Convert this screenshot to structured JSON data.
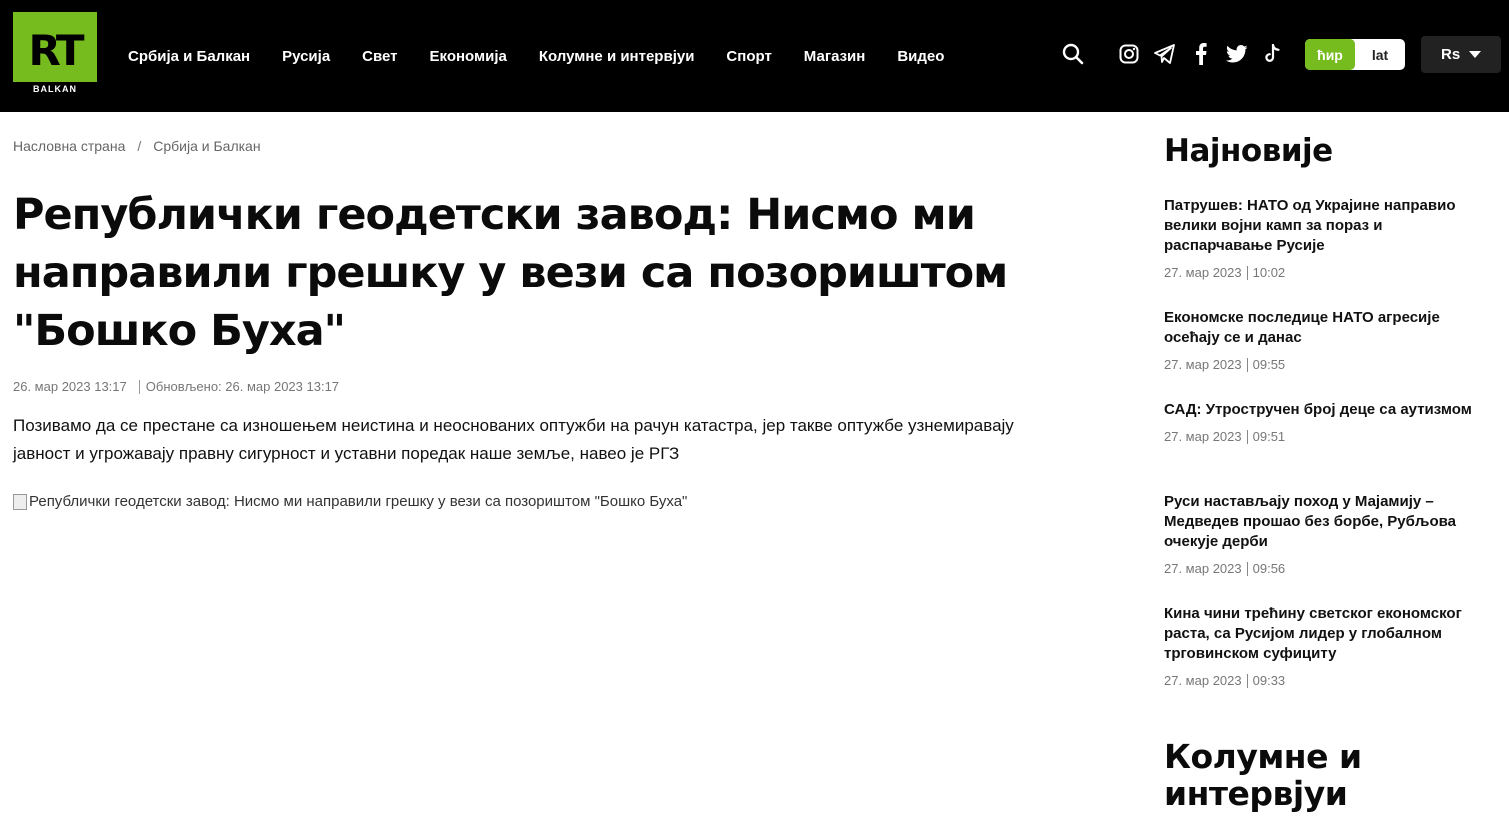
{
  "brand": {
    "logo_text": "RT",
    "logo_sub": "BALKAN",
    "accent": "#77bc1f",
    "header_bg": "#000000"
  },
  "nav": {
    "items": [
      {
        "label": "Србија и Балкан"
      },
      {
        "label": "Русија"
      },
      {
        "label": "Свет"
      },
      {
        "label": "Економија"
      },
      {
        "label": "Колумне и интервјуи"
      },
      {
        "label": "Спорт"
      },
      {
        "label": "Магазин"
      },
      {
        "label": "Видео"
      }
    ]
  },
  "header_icons": [
    "search-icon",
    "instagram-icon",
    "telegram-icon",
    "facebook-icon",
    "twitter-icon",
    "tiktok-icon"
  ],
  "script_toggle": {
    "cyr": "ћир",
    "lat": "lat",
    "selected": "ћир"
  },
  "region": {
    "label": "Rs"
  },
  "breadcrumb": {
    "home": "Насловна страна",
    "sep": "/",
    "section": "Србија и Балкан"
  },
  "article": {
    "title": "Републички геодетски завод: Нисмо ми направили грешку у вези са позориштом \"Бошко Буха\"",
    "published": "26. мар 2023 13:17",
    "updated": "Обновљено: 26. мар 2023 13:17",
    "lead": "Позивамо да се престане са изношењем неистина и неоснованих оптужби на рачун катастра, јер такве оптужбе узнемиравају јавност и угрожавају правну сигурност и уставни поредак наше земље, навео је РГЗ",
    "image_alt": "Републички геодетски завод: Нисмо ми направили грешку у вези са позориштом \"Бошко Буха\""
  },
  "sidebar": {
    "title": "Најновије",
    "items": [
      {
        "headline": "Патрушев: НАТО од Украјине направио велики војни камп за пораз и распарчавање Русије",
        "date": "27. мар 2023",
        "time": "10:02"
      },
      {
        "headline": "Економске последице НАТО агресије осећају се и данас",
        "date": "27. мар 2023",
        "time": "09:55"
      },
      {
        "headline": "САД: Утростручен број деце са аутизмом",
        "date": "27. мар 2023",
        "time": "09:51"
      },
      {
        "headline": "Руси настављају поход у Мајамију – Медведев прошао без борбе, Рубљова очекује дерби",
        "date": "27. мар 2023",
        "time": "09:56"
      },
      {
        "headline": "Кина чини трећину светског економског раста, са Русијом лидер у глобалном трговинском суфициту",
        "date": "27. мар 2023",
        "time": "09:33"
      }
    ],
    "section2_title": "Колумне и интервјуи"
  }
}
